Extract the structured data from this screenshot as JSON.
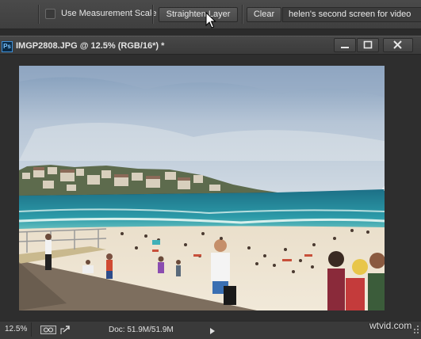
{
  "options_bar": {
    "use_measurement_scale_label": "Use Measurement Scale",
    "use_measurement_scale_checked": false,
    "straighten_layer_label": "Straighten Layer",
    "clear_label": "Clear",
    "note_field_value": "helen's second screen for video"
  },
  "document": {
    "app_icon_text": "Ps",
    "title": "IMGP2808.JPG @ 12.5% (RGB/16*) *"
  },
  "status_bar": {
    "zoom": "12.5%",
    "doc_size": "Doc: 51.9M/51.9M"
  },
  "watermark": "wtvid.com",
  "icons": [
    "checkbox-icon",
    "ps-app-icon",
    "minimize-icon",
    "maximize-icon",
    "close-icon",
    "mouse-pointer-icon",
    "status-share-icon",
    "status-arrow-icon",
    "resize-grip-icon"
  ]
}
